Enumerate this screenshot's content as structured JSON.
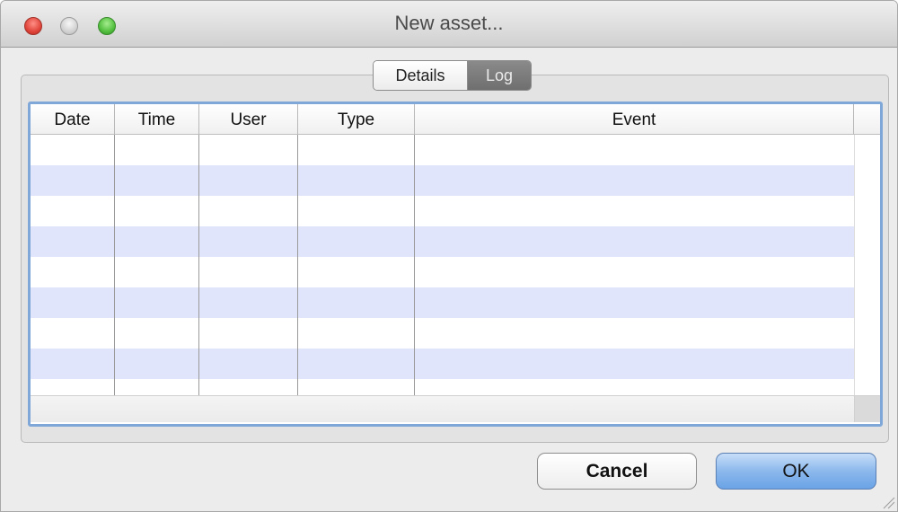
{
  "window": {
    "title": "New asset..."
  },
  "tabs": [
    {
      "label": "Details",
      "selected": false
    },
    {
      "label": "Log",
      "selected": true
    }
  ],
  "table": {
    "columns": [
      "Date",
      "Time",
      "User",
      "Type",
      "Event"
    ],
    "rows": []
  },
  "buttons": {
    "cancel": "Cancel",
    "ok": "OK"
  },
  "colors": {
    "row_alt": "#e0e5fb",
    "focus_ring": "#7fa7d8",
    "ok_button": "#8cb8ec"
  },
  "icons": {
    "close": "close-light-icon",
    "minimize": "minimize-light-icon",
    "zoom": "zoom-light-icon",
    "resize": "resize-grip-icon"
  }
}
